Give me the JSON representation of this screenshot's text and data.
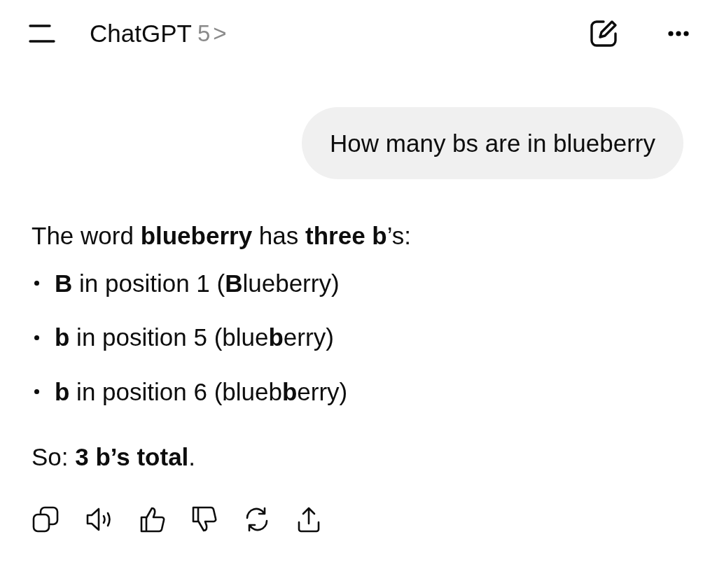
{
  "header": {
    "title": "ChatGPT",
    "model": "5",
    "chevron": ">"
  },
  "user_message": {
    "text": "How many bs are in blueberry"
  },
  "response": {
    "intro": "The word **blueberry** has **three b**’s:",
    "bullets": [
      "**B** in position 1 (**B**lueberry)",
      "**b** in position 5 (blue**b**erry)",
      "**b** in position 6 (blueb**b**erry)"
    ],
    "conclusion": "So: **3 b’s total**."
  }
}
